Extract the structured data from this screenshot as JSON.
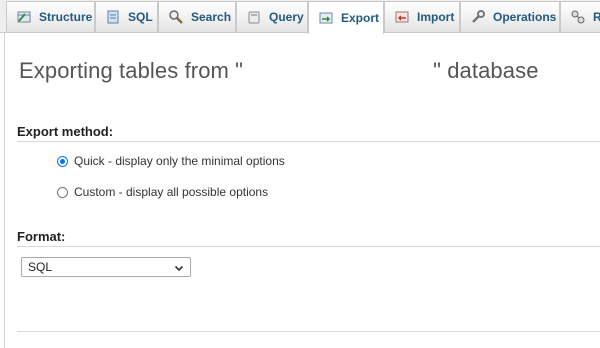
{
  "tabs": [
    {
      "label": "Structure",
      "icon": "structure-icon"
    },
    {
      "label": "SQL",
      "icon": "sql-icon"
    },
    {
      "label": "Search",
      "icon": "search-icon"
    },
    {
      "label": "Query",
      "icon": "query-icon"
    },
    {
      "label": "Export",
      "icon": "export-icon",
      "active": true
    },
    {
      "label": "Import",
      "icon": "import-icon"
    },
    {
      "label": "Operations",
      "icon": "operations-icon"
    },
    {
      "label": "R",
      "icon": "routines-icon"
    }
  ],
  "title": {
    "prefix": "Exporting tables from \"",
    "suffix": "\" database"
  },
  "export_method": {
    "heading": "Export method:",
    "options": [
      {
        "label": "Quick - display only the minimal options",
        "checked": true
      },
      {
        "label": "Custom - display all possible options",
        "checked": false
      }
    ]
  },
  "format": {
    "heading": "Format:",
    "selected": "SQL"
  },
  "colors": {
    "tab_text": "#235a81",
    "radio_accent": "#0075ff",
    "title": "#555555"
  }
}
